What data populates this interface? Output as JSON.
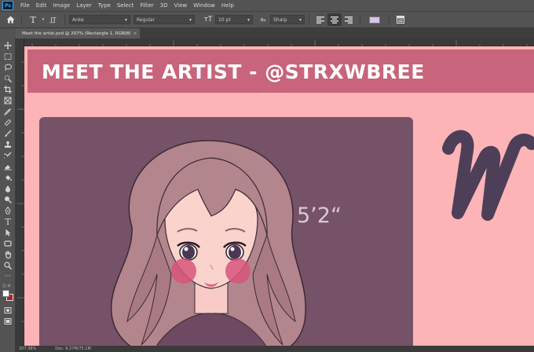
{
  "menubar": {
    "logo": "Ps",
    "items": [
      "File",
      "Edit",
      "Image",
      "Layer",
      "Type",
      "Select",
      "Filter",
      "3D",
      "View",
      "Window",
      "Help"
    ]
  },
  "options": {
    "font_family": "Anke",
    "font_style": "Regular",
    "font_size": "10 pt",
    "anti_alias": "Sharp",
    "text_color": "#d9c3e6"
  },
  "document": {
    "tab_title": "Meet the artist.psd @ 207% (Rectangle 1, RGB/8)",
    "close_glyph": "×"
  },
  "artwork": {
    "banner_title": "MEET THE ARTIST - @STRXWBREE",
    "height_text": "5’2“",
    "colors": {
      "background": "#fcb4b6",
      "banner": "#c8647b",
      "card": "#755267",
      "script": "#4e3f59"
    }
  },
  "status": {
    "zoom": "207.38%",
    "doc": "Doc: 9.27M/75.1M"
  }
}
